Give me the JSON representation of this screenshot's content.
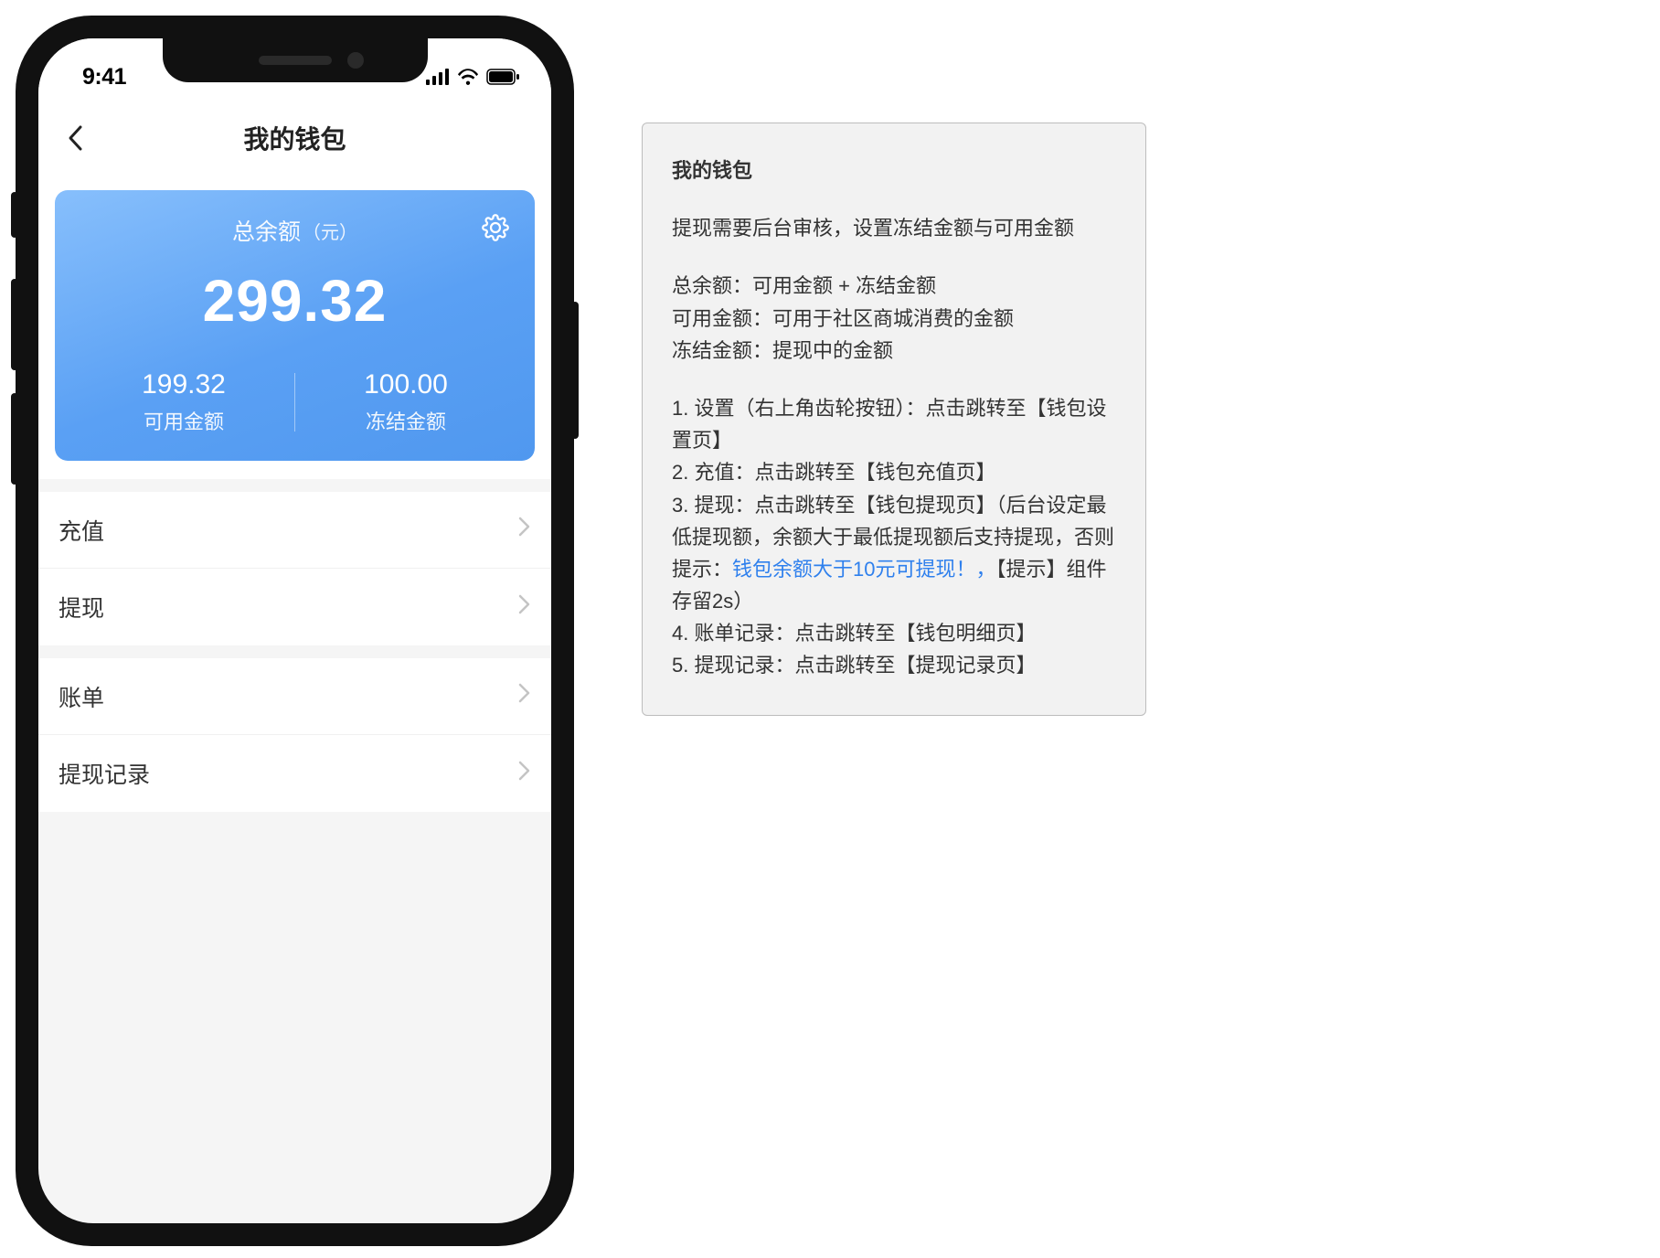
{
  "statusbar": {
    "time": "9:41"
  },
  "nav": {
    "title": "我的钱包"
  },
  "balance": {
    "label": "总余额",
    "unit": "（元）",
    "total": "299.32",
    "available_value": "199.32",
    "available_label": "可用金额",
    "frozen_value": "100.00",
    "frozen_label": "冻结金额"
  },
  "menu": {
    "group1": [
      {
        "label": "充值"
      },
      {
        "label": "提现"
      }
    ],
    "group2": [
      {
        "label": "账单"
      },
      {
        "label": "提现记录"
      }
    ]
  },
  "spec": {
    "title": "我的钱包",
    "intro": "提现需要后台审核，设置冻结金额与可用金额",
    "def1": "总余额：可用金额 + 冻结金额",
    "def2": "可用金额：可用于社区商城消费的金额",
    "def3": "冻结金额：提现中的金额",
    "item1": "1. 设置（右上角齿轮按钮）：点击跳转至【钱包设置页】",
    "item2": "2. 充值：点击跳转至【钱包充值页】",
    "item3a": "3. 提现：点击跳转至【钱包提现页】（后台设定最低提现额，余额大于最低提现额后支持提现，否则提示：",
    "item3link": "钱包余额大于10元可提现！，",
    "item3b": "【提示】组件存留2s）",
    "item4": "4. 账单记录：点击跳转至【钱包明细页】",
    "item5": "5. 提现记录：点击跳转至【提现记录页】"
  }
}
